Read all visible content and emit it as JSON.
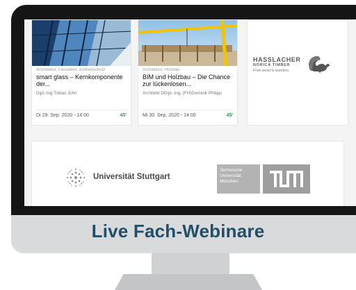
{
  "screen": {
    "cards": [
      {
        "category": "Architektur, Fassaden, Sonnenschutz",
        "title": "smart glass – Kernkomponente der...",
        "author": "Dipl.-Ing Tobias John",
        "date": "Di 29. Sep. 2020 - 14:00",
        "duration": "45'"
      },
      {
        "category": "Architektur, Holzbau",
        "title": "BIM und Holzbau – Die Chance zur lückenlosen...",
        "author": "Architekt DDipl.-Ing. (FH)Dominik Philipp",
        "date": "Mi 30. Sep. 2020 - 14:00",
        "duration": "45'"
      }
    ],
    "sponsor": {
      "name": "HASSLACHER",
      "subname": "NORICA TIMBER",
      "tagline": "From wood to wonders."
    },
    "partners": {
      "ustutt": "Universität Stuttgart",
      "tum_text": [
        "Technische",
        "Universität",
        "München"
      ]
    }
  },
  "banner": {
    "title": "Live Fach-Webinare"
  },
  "colors": {
    "banner_text": "#234e6a",
    "duration": "#2ca24a",
    "bezel": "#151515",
    "chin": "#d9dadb"
  }
}
